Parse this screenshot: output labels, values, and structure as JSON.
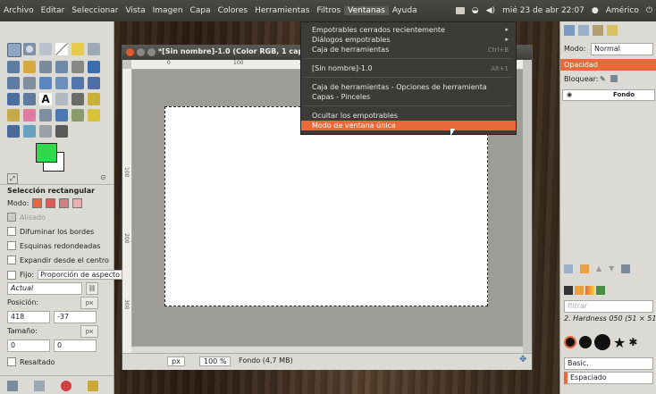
{
  "menubar": {
    "items": [
      "Archivo",
      "Editar",
      "Seleccionar",
      "Vista",
      "Imagen",
      "Capa",
      "Colores",
      "Herramientas",
      "Filtros",
      "Ventanas",
      "Ayuda"
    ],
    "active_index": 9
  },
  "indicators": {
    "datetime": "mié 23 de abr 22:07",
    "user": "Américo"
  },
  "window": {
    "title": "*[Sin nombre]-1.0 (Color RGB, 1 capa) 64",
    "ruler_ticks": [
      "0",
      "100",
      "200"
    ],
    "vruler_ticks": [
      "100",
      "200",
      "300"
    ]
  },
  "ventanas_menu": {
    "items": [
      {
        "label": "Empotrables cerrados recientemente",
        "shortcut": "",
        "submenu": true
      },
      {
        "label": "Diálogos empotrables",
        "shortcut": "",
        "submenu": true
      },
      {
        "label": "Caja de herramientas",
        "shortcut": "Ctrl+B"
      },
      {
        "label": "[Sin nombre]-1.0",
        "shortcut": "Alt+1"
      },
      {
        "label": "Caja de herramientas - Opciones de herramienta",
        "shortcut": ""
      },
      {
        "label": "Capas - Pinceles",
        "shortcut": ""
      },
      {
        "label": "Ocultar los empotrables",
        "shortcut": ""
      },
      {
        "label": "Modo de ventana única",
        "shortcut": "",
        "highlighted": true
      }
    ]
  },
  "tool_options": {
    "title": "Selección rectangular",
    "mode_label": "Modo:",
    "antialias": "Alisado",
    "feather": "Difuminar los bordes",
    "rounded": "Esquinas redondeadas",
    "expand_center": "Expandir desde el centro",
    "fixed_label": "Fijo:",
    "fixed_value": "Proporción de aspecto",
    "actual": "Actual",
    "position_label": "Posición:",
    "pos_x": "418",
    "pos_y": "-37",
    "size_label": "Tamaño:",
    "size_w": "0",
    "size_h": "0",
    "highlight": "Resaltado",
    "unit": "px"
  },
  "statusbar": {
    "unit": "px",
    "zoom": "100 %",
    "info": "Fondo (4,7 MB)"
  },
  "dock": {
    "mode_label": "Modo:",
    "mode_value": "Normal",
    "opacity_label": "Opacidad",
    "lock_label": "Bloquear:",
    "layer_name": "Fondo",
    "filter_placeholder": "filtrar",
    "brush_name": "2. Hardness 050 (51 × 51)",
    "preset": "Basic.",
    "spacing": "Espaciado"
  },
  "colors": {
    "foreground": "#2fd94b",
    "background": "#ffffff",
    "accent": "#e9693a"
  }
}
